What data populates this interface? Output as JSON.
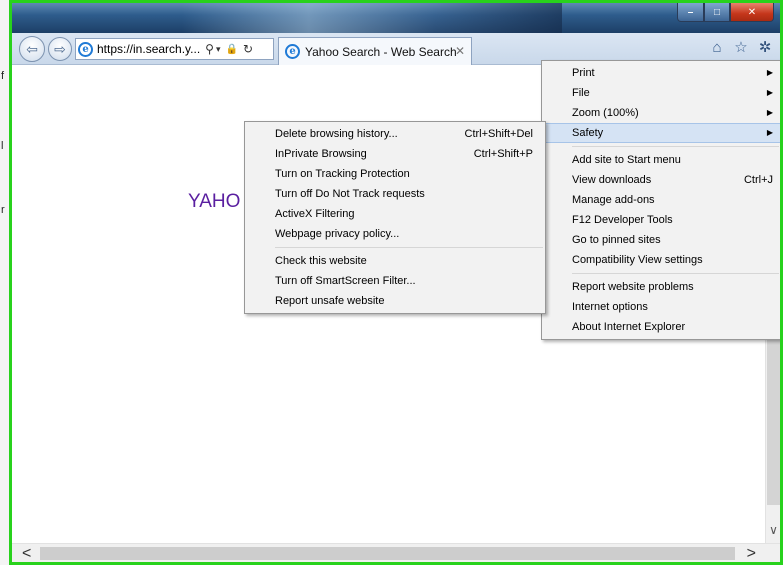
{
  "background_window": {
    "fragments": [
      "f",
      "l",
      "r"
    ]
  },
  "window_controls": {
    "minimize": "–",
    "maximize": "□",
    "close": "✕"
  },
  "address_bar": {
    "url": "https://in.search.y...",
    "search_icon": "⚲",
    "lock_icon": "🔒",
    "refresh_icon": "↻"
  },
  "tab": {
    "title": "Yahoo Search - Web Search",
    "close": "✕"
  },
  "toolbar_icons": {
    "home": "⌂",
    "favorites": "☆",
    "tools": "✲"
  },
  "content": {
    "logo_partial": "YAHO"
  },
  "tools_menu": {
    "items": [
      {
        "label": "Print",
        "submenu": true
      },
      {
        "label": "File",
        "submenu": true
      },
      {
        "label": "Zoom (100%)",
        "submenu": true
      },
      {
        "label": "Safety",
        "submenu": true,
        "highlighted": true
      },
      {
        "label": "Add site to Start menu"
      },
      {
        "label": "View downloads",
        "shortcut": "Ctrl+J"
      },
      {
        "label": "Manage add-ons"
      },
      {
        "label": "F12 Developer Tools"
      },
      {
        "label": "Go to pinned sites"
      },
      {
        "label": "Compatibility View settings"
      },
      {
        "label": "Report website problems"
      },
      {
        "label": "Internet options"
      },
      {
        "label": "About Internet Explorer"
      }
    ]
  },
  "safety_submenu": {
    "items": [
      {
        "label": "Delete browsing history...",
        "shortcut": "Ctrl+Shift+Del"
      },
      {
        "label": "InPrivate Browsing",
        "shortcut": "Ctrl+Shift+P"
      },
      {
        "label": "Turn on Tracking Protection"
      },
      {
        "label": "Turn off Do Not Track requests"
      },
      {
        "label": "ActiveX Filtering"
      },
      {
        "label": "Webpage privacy policy..."
      },
      {
        "label": "Check this website"
      },
      {
        "label": "Turn off SmartScreen Filter..."
      },
      {
        "label": "Report unsafe website"
      }
    ]
  },
  "scrollbars": {
    "left_arrow": "<",
    "right_arrow": ">",
    "down_arrow": "∨"
  }
}
